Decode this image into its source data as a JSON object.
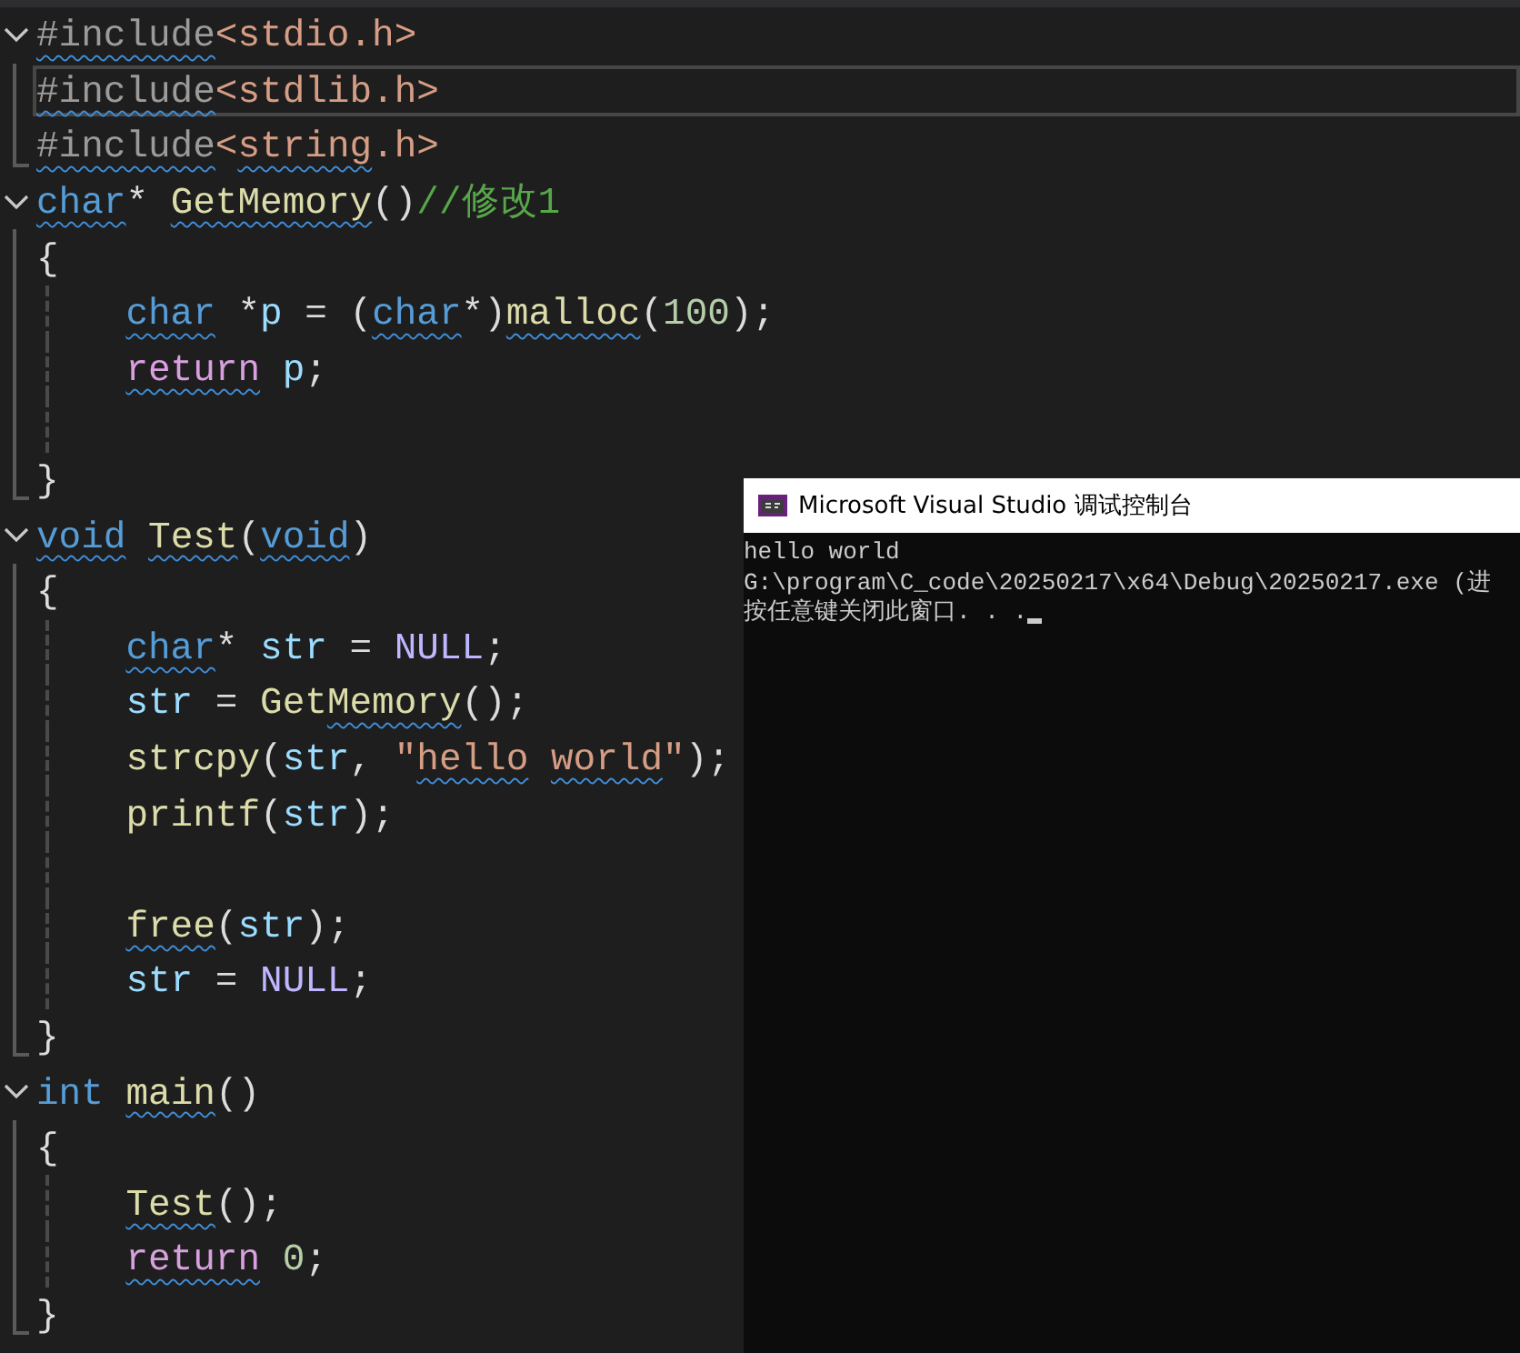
{
  "editor": {
    "lines": [
      {
        "kind": "fold",
        "current": false,
        "indented": false,
        "tokens": [
          {
            "text": "#include",
            "kind": "preproc",
            "squiggle": true
          },
          {
            "text": "<stdio.h>",
            "kind": "string",
            "squiggle": false
          }
        ]
      },
      {
        "kind": "bar",
        "current": true,
        "indented": false,
        "tokens": [
          {
            "text": "#include",
            "kind": "preproc",
            "squiggle": true
          },
          {
            "text": "<stdlib.h>",
            "kind": "string",
            "squiggle": false
          }
        ]
      },
      {
        "kind": "end",
        "current": false,
        "indented": false,
        "tokens": [
          {
            "text": "#include",
            "kind": "preproc",
            "squiggle": true
          },
          {
            "text": "<",
            "kind": "string",
            "squiggle": false
          },
          {
            "text": "string",
            "kind": "string",
            "squiggle": true
          },
          {
            "text": ".h>",
            "kind": "string",
            "squiggle": false
          }
        ]
      },
      {
        "kind": "fold",
        "current": false,
        "indented": false,
        "tokens": [
          {
            "text": "char",
            "kind": "keyword",
            "squiggle": true
          },
          {
            "text": "* ",
            "kind": "plain",
            "squiggle": false
          },
          {
            "text": "GetMemory",
            "kind": "function",
            "squiggle": true
          },
          {
            "text": "()",
            "kind": "plain",
            "squiggle": false
          },
          {
            "text": "//修改1",
            "kind": "comment",
            "squiggle": false
          }
        ]
      },
      {
        "kind": "bar",
        "current": false,
        "indented": false,
        "tokens": [
          {
            "text": "{",
            "kind": "plain",
            "squiggle": false
          }
        ]
      },
      {
        "kind": "body",
        "current": false,
        "indented": true,
        "tokens": [
          {
            "text": "char",
            "kind": "keyword",
            "squiggle": true
          },
          {
            "text": " *",
            "kind": "plain",
            "squiggle": false
          },
          {
            "text": "p",
            "kind": "variable",
            "squiggle": false
          },
          {
            "text": " = (",
            "kind": "plain",
            "squiggle": false
          },
          {
            "text": "char",
            "kind": "keyword",
            "squiggle": true
          },
          {
            "text": "*)",
            "kind": "plain",
            "squiggle": false
          },
          {
            "text": "malloc",
            "kind": "function",
            "squiggle": true
          },
          {
            "text": "(",
            "kind": "plain",
            "squiggle": false
          },
          {
            "text": "100",
            "kind": "number",
            "squiggle": false
          },
          {
            "text": ");",
            "kind": "plain",
            "squiggle": false
          }
        ]
      },
      {
        "kind": "body",
        "current": false,
        "indented": true,
        "tokens": [
          {
            "text": "return",
            "kind": "control",
            "squiggle": true
          },
          {
            "text": " p",
            "kind": "variable",
            "squiggle": false
          },
          {
            "text": ";",
            "kind": "plain",
            "squiggle": false
          }
        ]
      },
      {
        "kind": "body",
        "current": false,
        "indented": false
      },
      {
        "kind": "end",
        "current": false,
        "indented": false,
        "tokens": [
          {
            "text": "}",
            "kind": "plain",
            "squiggle": false
          }
        ]
      },
      {
        "kind": "fold",
        "current": false,
        "indented": false,
        "tokens": [
          {
            "text": "void",
            "kind": "keyword",
            "squiggle": true
          },
          {
            "text": " Test",
            "kind": "function",
            "squiggle": true
          },
          {
            "text": "(",
            "kind": "plain",
            "squiggle": false
          },
          {
            "text": "void",
            "kind": "keyword",
            "squiggle": true
          },
          {
            "text": ")",
            "kind": "plain",
            "squiggle": false
          }
        ]
      },
      {
        "kind": "bar",
        "current": false,
        "indented": false,
        "tokens": [
          {
            "text": "{",
            "kind": "plain",
            "squiggle": false
          }
        ]
      },
      {
        "kind": "body",
        "current": false,
        "indented": true,
        "tokens": [
          {
            "text": "char",
            "kind": "keyword",
            "squiggle": true
          },
          {
            "text": "* ",
            "kind": "plain",
            "squiggle": false
          },
          {
            "text": "str",
            "kind": "variable",
            "squiggle": false
          },
          {
            "text": " = ",
            "kind": "plain",
            "squiggle": false
          },
          {
            "text": "NULL",
            "kind": "macro",
            "squiggle": false
          },
          {
            "text": ";",
            "kind": "plain",
            "squiggle": false
          }
        ]
      },
      {
        "kind": "body",
        "current": false,
        "indented": true,
        "tokens": [
          {
            "text": "str",
            "kind": "variable",
            "squiggle": false
          },
          {
            "text": " = ",
            "kind": "plain",
            "squiggle": false
          },
          {
            "text": "Get",
            "kind": "function",
            "squiggle": false
          },
          {
            "text": "Memory",
            "kind": "function",
            "squiggle": true
          },
          {
            "text": "();",
            "kind": "plain",
            "squiggle": false
          }
        ]
      },
      {
        "kind": "body",
        "current": false,
        "indented": true,
        "tokens": [
          {
            "text": "strcpy",
            "kind": "function",
            "squiggle": false
          },
          {
            "text": "(",
            "kind": "plain",
            "squiggle": false
          },
          {
            "text": "str",
            "kind": "variable",
            "squiggle": false
          },
          {
            "text": ", ",
            "kind": "plain",
            "squiggle": false
          },
          {
            "text": "\"",
            "kind": "string",
            "squiggle": false
          },
          {
            "text": "hello",
            "kind": "string",
            "squiggle": true
          },
          {
            "text": " world",
            "kind": "string",
            "squiggle": true
          },
          {
            "text": "\"",
            "kind": "string",
            "squiggle": false
          },
          {
            "text": ");",
            "kind": "plain",
            "squiggle": false
          }
        ]
      },
      {
        "kind": "body",
        "current": false,
        "indented": true,
        "tokens": [
          {
            "text": "printf",
            "kind": "function",
            "squiggle": false
          },
          {
            "text": "(",
            "kind": "plain",
            "squiggle": false
          },
          {
            "text": "str",
            "kind": "variable",
            "squiggle": false
          },
          {
            "text": ");",
            "kind": "plain",
            "squiggle": false
          }
        ]
      },
      {
        "kind": "body",
        "current": false,
        "indented": false
      },
      {
        "kind": "body",
        "current": false,
        "indented": true,
        "tokens": [
          {
            "text": "free",
            "kind": "function",
            "squiggle": true
          },
          {
            "text": "(",
            "kind": "plain",
            "squiggle": false
          },
          {
            "text": "str",
            "kind": "variable",
            "squiggle": false
          },
          {
            "text": ");",
            "kind": "plain",
            "squiggle": false
          }
        ]
      },
      {
        "kind": "body",
        "current": false,
        "indented": true,
        "tokens": [
          {
            "text": "str",
            "kind": "variable",
            "squiggle": false
          },
          {
            "text": " = ",
            "kind": "plain",
            "squiggle": false
          },
          {
            "text": "NULL",
            "kind": "macro",
            "squiggle": false
          },
          {
            "text": ";",
            "kind": "plain",
            "squiggle": false
          }
        ]
      },
      {
        "kind": "end",
        "current": false,
        "indented": false,
        "tokens": [
          {
            "text": "}",
            "kind": "plain",
            "squiggle": false
          }
        ]
      },
      {
        "kind": "fold",
        "current": false,
        "indented": false,
        "tokens": [
          {
            "text": "int",
            "kind": "keyword",
            "squiggle": false
          },
          {
            "text": " main",
            "kind": "function",
            "squiggle": true
          },
          {
            "text": "()",
            "kind": "plain",
            "squiggle": false
          }
        ]
      },
      {
        "kind": "bar",
        "current": false,
        "indented": false,
        "tokens": [
          {
            "text": "{",
            "kind": "plain",
            "squiggle": false
          }
        ]
      },
      {
        "kind": "body",
        "current": false,
        "indented": true,
        "tokens": [
          {
            "text": "Test",
            "kind": "function",
            "squiggle": true
          },
          {
            "text": "();",
            "kind": "plain",
            "squiggle": false
          }
        ]
      },
      {
        "kind": "body",
        "current": false,
        "indented": true,
        "tokens": [
          {
            "text": "return",
            "kind": "control",
            "squiggle": true
          },
          {
            "text": " 0",
            "kind": "number",
            "squiggle": false
          },
          {
            "text": ";",
            "kind": "plain",
            "squiggle": false
          }
        ]
      },
      {
        "kind": "end",
        "current": false,
        "indented": false,
        "tokens": [
          {
            "text": "}",
            "kind": "plain",
            "squiggle": false
          }
        ]
      }
    ]
  },
  "console": {
    "title": "Microsoft Visual Studio 调试控制台",
    "output": [
      "hello world",
      "G:\\program\\C_code\\20250217\\x64\\Debug\\20250217.exe (进",
      "按任意键关闭此窗口. . ."
    ],
    "cursor": true
  }
}
